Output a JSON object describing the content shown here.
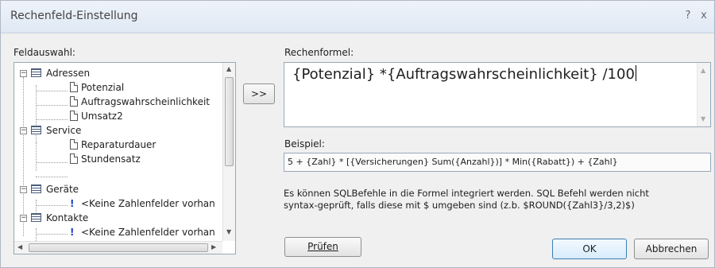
{
  "window": {
    "title": "Rechenfeld-Einstellung",
    "help_glyph": "?",
    "close_glyph": "x"
  },
  "field_panel": {
    "label": "Feldauswahl:",
    "tree": [
      {
        "label": "Adressen",
        "type": "table",
        "expanded": true
      },
      {
        "label": "Potenzial",
        "type": "field"
      },
      {
        "label": "Auftragswahrscheinlichkeit",
        "type": "field"
      },
      {
        "label": "Umsatz2",
        "type": "field"
      },
      {
        "label": "Service",
        "type": "table",
        "expanded": true
      },
      {
        "label": "Reparaturdauer",
        "type": "field"
      },
      {
        "label": "Stundensatz",
        "type": "field"
      },
      {
        "label": "Geräte",
        "type": "table",
        "expanded": true
      },
      {
        "label": "<Keine Zahlenfelder vorhan",
        "type": "warning"
      },
      {
        "label": "Kontakte",
        "type": "table",
        "expanded": true
      },
      {
        "label": "<Keine Zahlenfelder vorhan",
        "type": "warning"
      }
    ]
  },
  "insert_button": {
    "label": ">>"
  },
  "formula_panel": {
    "label": "Rechenformel:",
    "value": "{Potenzial} *{Auftragswahrscheinlichkeit} /100"
  },
  "example_panel": {
    "label": "Beispiel:",
    "value": "5 + {Zahl} * [{Versicherungen} Sum({Anzahl})] * Min({Rabatt}) + {Zahl}"
  },
  "info_text": {
    "line1": "Es können SQLBefehle in die Formel integriert werden. SQL Befehl werden nicht",
    "line2": "syntax-geprüft, falls diese mit $ umgeben sind (z.b. $ROUND({Zahl3}/3,2)$)"
  },
  "buttons": {
    "check": "Prüfen",
    "ok": "OK",
    "cancel": "Abbrechen"
  }
}
